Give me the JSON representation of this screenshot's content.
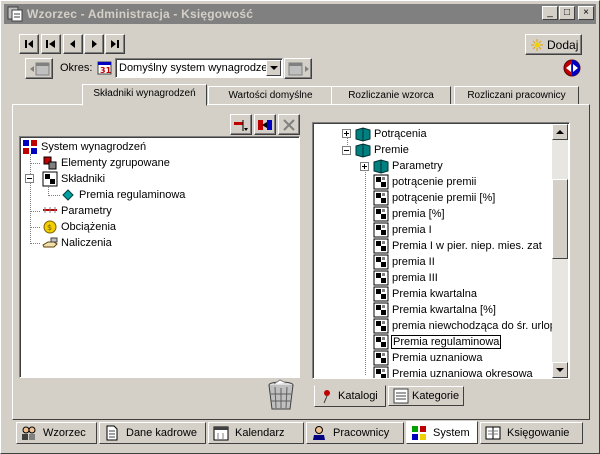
{
  "window": {
    "title": "Wzorzec - Administracja - Księgowość",
    "controls": {
      "minimize": "_",
      "maximize": "□",
      "close": "×"
    }
  },
  "toolbar": {
    "add_label": "Dodaj"
  },
  "okres": {
    "label": "Okres:",
    "value": "Domyślny system wynagrodzeń"
  },
  "tabs": [
    {
      "label": "Składniki wynagrodzeń",
      "active": true
    },
    {
      "label": "Wartości domyślne",
      "active": false
    },
    {
      "label": "Rozliczanie wzorca",
      "active": false
    },
    {
      "label": "Rozliczani pracownicy",
      "active": false
    }
  ],
  "left_tree": {
    "root": "System wynagrodzeń",
    "items": [
      "Elementy zgrupowane",
      "Składniki",
      "Premia regulaminowa",
      "Parametry",
      "Obciążenia",
      "Naliczenia"
    ]
  },
  "right_tree": {
    "folders": [
      "Potrącenia",
      "Premie",
      "Parametry"
    ],
    "items": [
      "potrącenie premii",
      "potrącenie premii [%]",
      "premia [%]",
      "premia I",
      "Premia I w pier. niep. mies. zat",
      "premia II",
      "premia III",
      "Premia kwartalna",
      "Premia kwartalna [%]",
      "premia niewchodząca do śr. urlop",
      "Premia regulaminowa",
      "Premia uznaniowa",
      "Premia uznaniowa okresowa"
    ],
    "selected": "Premia regulaminowa"
  },
  "catalog_tabs": [
    {
      "label": "Katalogi",
      "active": true
    },
    {
      "label": "Kategorie",
      "active": false
    }
  ],
  "bottom_tabs": [
    {
      "label": "Wzorzec",
      "active": false
    },
    {
      "label": "Dane kadrowe",
      "active": false
    },
    {
      "label": "Kalendarz",
      "active": false
    },
    {
      "label": "Pracownicy",
      "active": false
    },
    {
      "label": "System",
      "active": true
    },
    {
      "label": "Księgowanie",
      "active": false
    }
  ],
  "colors": {
    "face": "#d4d0c8",
    "title_inactive": "#808080",
    "book_teal": "#008080",
    "sun_yellow": "#f0d000"
  }
}
